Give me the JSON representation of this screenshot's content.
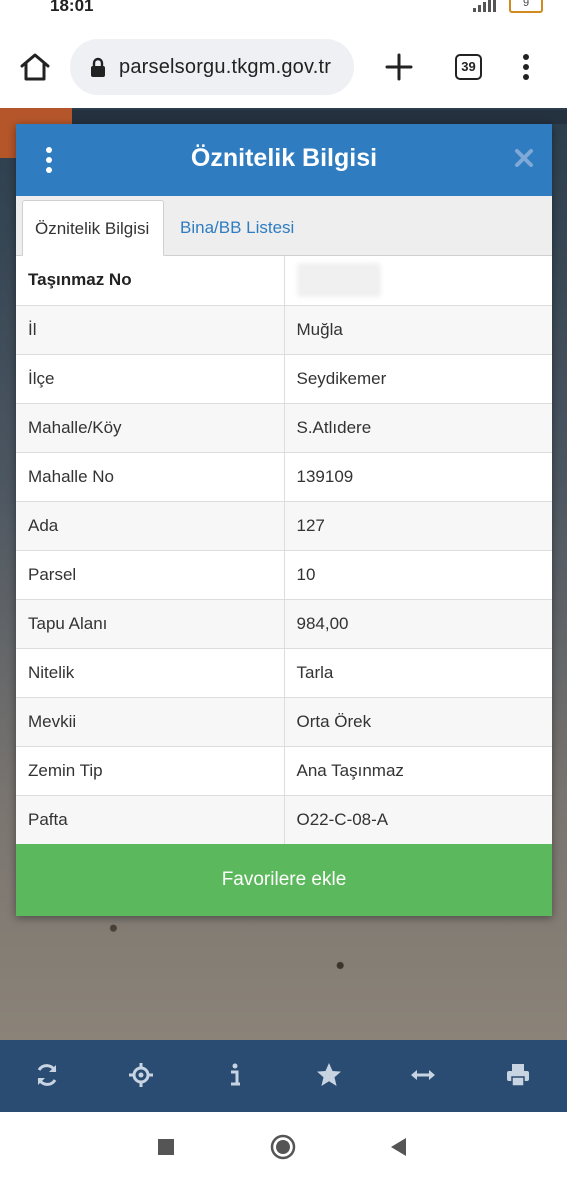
{
  "status": {
    "time": "18:01",
    "battery": "9"
  },
  "browser": {
    "url": "parselsorgu.tkgm.gov.tr",
    "tab_count": "39"
  },
  "modal": {
    "title": "Öznitelik Bilgisi",
    "tabs": [
      {
        "label": "Öznitelik Bilgisi"
      },
      {
        "label": "Bina/BB Listesi"
      }
    ],
    "rows": [
      {
        "label": "Taşınmaz No",
        "value": ""
      },
      {
        "label": "İl",
        "value": "Muğla"
      },
      {
        "label": "İlçe",
        "value": "Seydikemer"
      },
      {
        "label": "Mahalle/Köy",
        "value": "S.Atlıdere"
      },
      {
        "label": "Mahalle No",
        "value": "139109"
      },
      {
        "label": "Ada",
        "value": "127"
      },
      {
        "label": "Parsel",
        "value": "10"
      },
      {
        "label": "Tapu Alanı",
        "value": "984,00"
      },
      {
        "label": "Nitelik",
        "value": "Tarla"
      },
      {
        "label": "Mevkii",
        "value": "Orta Örek"
      },
      {
        "label": "Zemin Tip",
        "value": "Ana Taşınmaz"
      },
      {
        "label": "Pafta",
        "value": "O22-C-08-A"
      }
    ],
    "favorite_button": "Favorilere ekle"
  },
  "colors": {
    "header_blue": "#2f7cc1",
    "button_green": "#5cb85c",
    "toolbar_navy": "#2a4c73"
  },
  "icons": {
    "toolbar": [
      "refresh-icon",
      "locate-icon",
      "info-icon",
      "star-icon",
      "measure-icon",
      "print-icon"
    ],
    "navbar": [
      "recents-icon",
      "home-icon",
      "back-icon"
    ]
  }
}
